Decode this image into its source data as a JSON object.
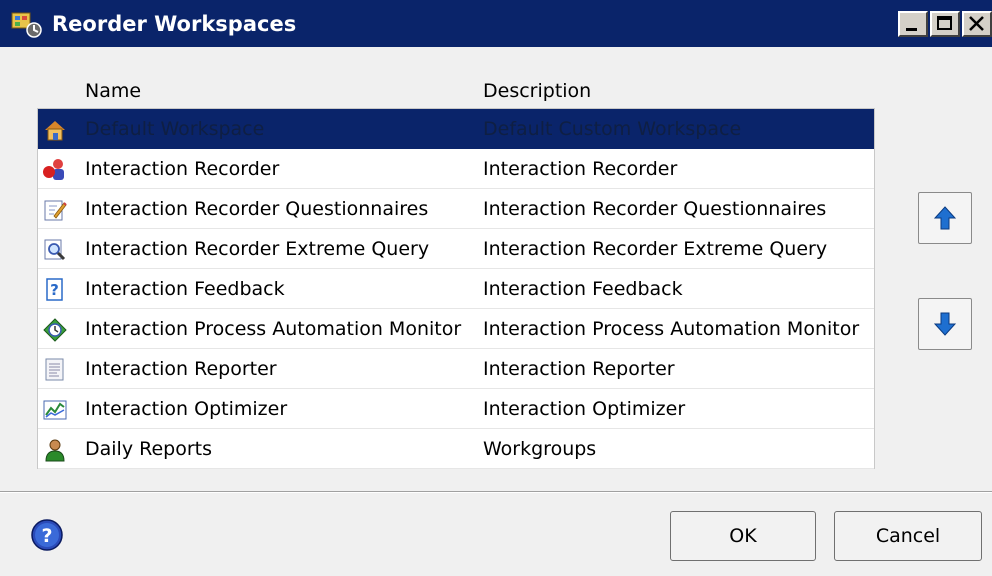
{
  "window": {
    "title": "Reorder Workspaces",
    "controls": [
      "minimize",
      "maximize",
      "close"
    ]
  },
  "list": {
    "columns": {
      "name": "Name",
      "description": "Description"
    },
    "rows": [
      {
        "name": "Default Workspace",
        "description": "Default Custom Workspace",
        "icon": "workspace-house-icon",
        "selected": true
      },
      {
        "name": "Interaction Recorder",
        "description": "Interaction Recorder",
        "icon": "recorder-people-icon",
        "selected": false
      },
      {
        "name": "Interaction Recorder Questionnaires",
        "description": "Interaction Recorder Questionnaires",
        "icon": "questionnaire-pencil-icon",
        "selected": false
      },
      {
        "name": "Interaction Recorder Extreme Query",
        "description": "Interaction Recorder Extreme Query",
        "icon": "query-magnifier-icon",
        "selected": false
      },
      {
        "name": "Interaction Feedback",
        "description": "Interaction Feedback",
        "icon": "feedback-question-icon",
        "selected": false
      },
      {
        "name": "Interaction Process Automation Monitor",
        "description": "Interaction Process Automation Monitor",
        "icon": "process-monitor-icon",
        "selected": false
      },
      {
        "name": "Interaction Reporter",
        "description": "Interaction Reporter",
        "icon": "report-document-icon",
        "selected": false
      },
      {
        "name": "Interaction Optimizer",
        "description": "Interaction Optimizer",
        "icon": "optimizer-chart-icon",
        "selected": false
      },
      {
        "name": "Daily Reports",
        "description": "Workgroups",
        "icon": "workgroup-person-icon",
        "selected": false
      }
    ]
  },
  "side_buttons": {
    "up_icon": "arrow-up-icon",
    "down_icon": "arrow-down-icon"
  },
  "footer": {
    "help_icon": "help-icon",
    "ok_label": "OK",
    "cancel_label": "Cancel"
  },
  "colors": {
    "titlebar": "#0a246a",
    "selection": "#0a246a",
    "arrow": "#1e6fd0"
  }
}
